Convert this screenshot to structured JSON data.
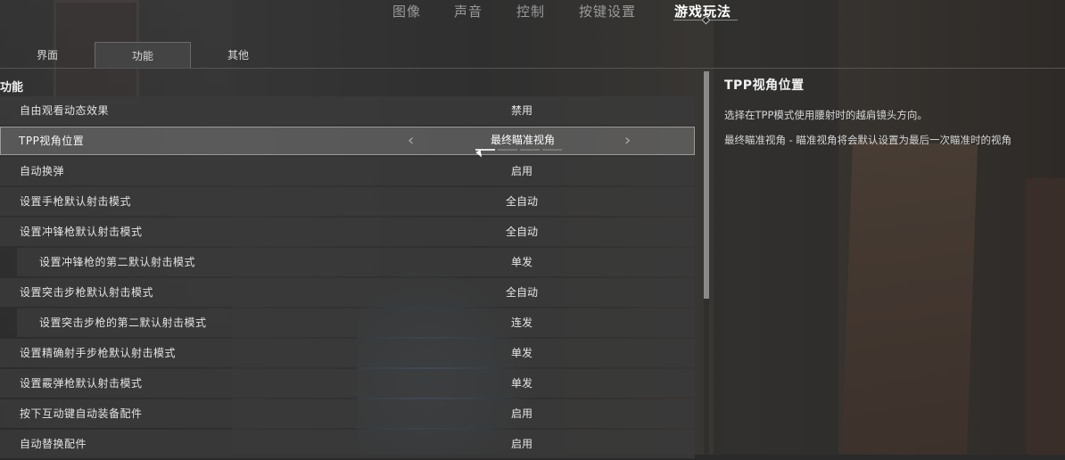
{
  "top_tabs": [
    {
      "label": "图像"
    },
    {
      "label": "声音"
    },
    {
      "label": "控制"
    },
    {
      "label": "按键设置"
    },
    {
      "label": "游戏玩法",
      "active": true
    }
  ],
  "sub_tabs": [
    {
      "label": "界面"
    },
    {
      "label": "功能",
      "active": true
    },
    {
      "label": "其他"
    }
  ],
  "section_title": "功能",
  "rows": [
    {
      "label": "自由观看动态效果",
      "value": "禁用"
    },
    {
      "label": "TPP视角位置",
      "value": "最终瞄准视角",
      "selected": true
    },
    {
      "label": "自动换弹",
      "value": "启用"
    },
    {
      "label": "设置手枪默认射击模式",
      "value": "全自动"
    },
    {
      "label": "设置冲锋枪默认射击模式",
      "value": "全自动"
    },
    {
      "label": "设置冲锋枪的第二默认射击模式",
      "value": "单发",
      "indented": true
    },
    {
      "label": "设置突击步枪默认射击模式",
      "value": "全自动"
    },
    {
      "label": "设置突击步枪的第二默认射击模式",
      "value": "连发",
      "indented": true
    },
    {
      "label": "设置精确射手步枪默认射击模式",
      "value": "单发"
    },
    {
      "label": "设置霰弹枪默认射击模式",
      "value": "单发"
    },
    {
      "label": "按下互动键自动装备配件",
      "value": "启用"
    },
    {
      "label": "自动替换配件",
      "value": "启用"
    }
  ],
  "selector": {
    "prev_icon": "‹",
    "next_icon": "›",
    "option_count": 4,
    "selected_index": 0
  },
  "description": {
    "title": "TPP视角位置",
    "line1": "选择在TPP模式使用腰射时的越肩镜头方向。",
    "line2": "最终瞄准视角 - 瞄准视角将会默认设置为最后一次瞄准时的视角"
  }
}
